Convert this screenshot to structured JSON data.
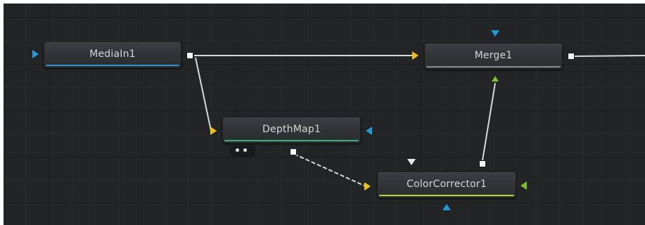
{
  "nodes": {
    "media_in": {
      "label": "MediaIn1",
      "stripe_color": "#2f90c8"
    },
    "merge": {
      "label": "Merge1",
      "stripe_color": "#8a8c90"
    },
    "depth_map": {
      "label": "DepthMap1",
      "stripe_color": "#3fae78"
    },
    "color_corrector": {
      "label": "ColorCorrector1",
      "stripe_color": "#b9d43a"
    }
  },
  "colors": {
    "background_input": "#f0c21a",
    "foreground_input": "#7fbf2a",
    "mask_input": "#1f9ad6",
    "output": "#f4f4f4",
    "wire": "#d8d8d8",
    "canvas": "#232426"
  },
  "icons": {
    "port_input_background": "yellow-triangle-icon",
    "port_input_foreground": "green-triangle-icon",
    "port_input_mask": "blue-triangle-icon",
    "port_output": "white-square-icon"
  }
}
